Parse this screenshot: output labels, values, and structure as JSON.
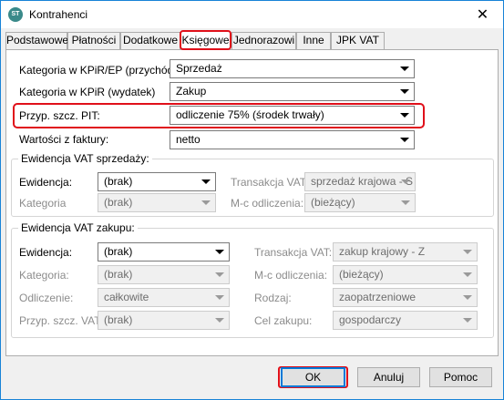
{
  "window": {
    "title": "Kontrahenci",
    "app_icon_text": "ST"
  },
  "tabs": [
    {
      "label": "Podstawowe"
    },
    {
      "label": "Płatności"
    },
    {
      "label": "Dodatkowe"
    },
    {
      "label": "Księgowe"
    },
    {
      "label": "Jednorazowi"
    },
    {
      "label": "Inne"
    },
    {
      "label": "JPK VAT"
    }
  ],
  "active_tab": "Księgowe",
  "fields": {
    "kpir_revenue": {
      "label": "Kategoria w KPiR/EP (przychód):",
      "value": "Sprzedaż"
    },
    "kpir_expense": {
      "label": "Kategoria w KPiR (wydatek)",
      "value": "Zakup"
    },
    "pit": {
      "label": "Przyp. szcz. PIT:",
      "value": "odliczenie 75% (środek trwały)"
    },
    "invoice_values": {
      "label": "Wartości z faktury:",
      "value": "netto"
    }
  },
  "vat_sales": {
    "title": "Ewidencja VAT sprzedaży:",
    "ewidencja": {
      "label": "Ewidencja:",
      "value": "(brak)"
    },
    "transakcja": {
      "label": "Transakcja VAT:",
      "value": "sprzedaż krajowa - S"
    },
    "kategoria": {
      "label": "Kategoria",
      "value": "(brak)"
    },
    "mc_odliczenia": {
      "label": "M-c odliczenia:",
      "value": "(bieżący)"
    }
  },
  "vat_purchase": {
    "title": "Ewidencja VAT zakupu:",
    "ewidencja": {
      "label": "Ewidencja:",
      "value": "(brak)"
    },
    "transakcja": {
      "label": "Transakcja VAT:",
      "value": "zakup krajowy - Z"
    },
    "kategoria": {
      "label": "Kategoria:",
      "value": "(brak)"
    },
    "mc_odliczenia": {
      "label": "M-c odliczenia:",
      "value": "(bieżący)"
    },
    "odliczenie": {
      "label": "Odliczenie:",
      "value": "całkowite"
    },
    "rodzaj": {
      "label": "Rodzaj:",
      "value": "zaopatrzeniowe"
    },
    "przyp_vat": {
      "label": "Przyp. szcz. VAT:",
      "value": "(brak)"
    },
    "cel_zakupu": {
      "label": "Cel zakupu:",
      "value": "gospodarczy"
    }
  },
  "buttons": {
    "ok": "OK",
    "cancel": "Anuluj",
    "help": "Pomoc"
  },
  "colors": {
    "highlight": "#e0101a",
    "window_border": "#1883d7",
    "accent": "#0078d7"
  }
}
